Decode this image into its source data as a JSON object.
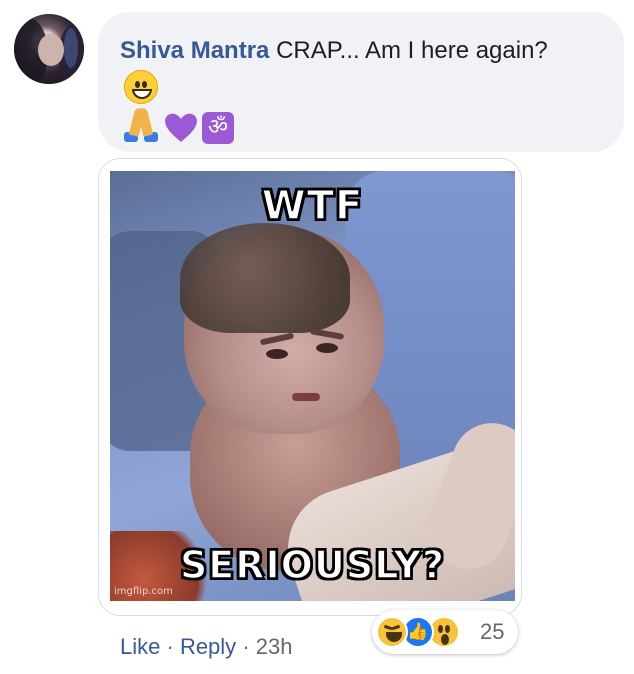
{
  "comment": {
    "author": "Shiva Mantra",
    "text": "CRAP... Am I here again?",
    "emojis": [
      "grinning-face",
      "folded-hands",
      "purple-heart",
      "om-symbol"
    ],
    "om_glyph": "ॐ"
  },
  "meme": {
    "top_text": "WTF",
    "bottom_text": "SERIOUSLY?",
    "watermark": "imgflip.com"
  },
  "actions": {
    "like_label": "Like",
    "reply_label": "Reply",
    "separator": "·",
    "timestamp": "23h"
  },
  "reactions": {
    "types": [
      "haha",
      "like",
      "wow"
    ],
    "count": "25",
    "like_glyph": "👍"
  },
  "colors": {
    "author_link": "#385898",
    "bubble_bg": "#f0f2f5",
    "meta_text": "#65676b",
    "like_blue": "#1877f2",
    "heart_purple": "#9b59d6"
  }
}
